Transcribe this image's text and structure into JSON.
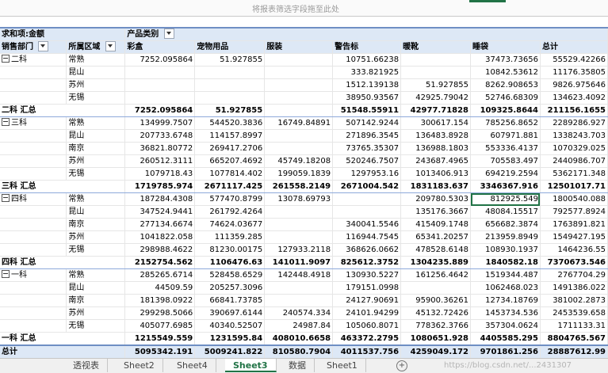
{
  "filter_drop_text": "将报表筛选字段拖至此处",
  "header": {
    "corner": "求和项:金额",
    "col_field": "产品类别",
    "row_field1": "销售部门",
    "row_field2": "所属区域",
    "columns": [
      "彩盒",
      "宠物用品",
      "服装",
      "警告标",
      "暖靴",
      "睡袋",
      "总计"
    ]
  },
  "rows": [
    {
      "type": "first",
      "dept": "二科",
      "region": "常熟",
      "vals": [
        "7252.095864",
        "51.927855",
        "",
        "10751.66238",
        "",
        "37473.73656",
        "55529.42266"
      ]
    },
    {
      "type": "item",
      "region": "昆山",
      "vals": [
        "",
        "",
        "",
        "333.821925",
        "",
        "10842.53612",
        "11176.35805"
      ]
    },
    {
      "type": "item",
      "region": "苏州",
      "vals": [
        "",
        "",
        "",
        "1512.139138",
        "51.927855",
        "8262.908653",
        "9826.975646"
      ]
    },
    {
      "type": "item",
      "region": "无锡",
      "vals": [
        "",
        "",
        "",
        "38950.93567",
        "42925.79042",
        "52746.68309",
        "134623.4092"
      ]
    },
    {
      "type": "sub",
      "label": "二科 汇总",
      "vals": [
        "7252.095864",
        "51.927855",
        "",
        "51548.55911",
        "42977.71828",
        "109325.8644",
        "211156.1655"
      ]
    },
    {
      "type": "first",
      "dept": "三科",
      "region": "常熟",
      "vals": [
        "134999.7507",
        "544520.3836",
        "16749.84891",
        "507142.9244",
        "300617.154",
        "785256.8652",
        "2289286.927"
      ]
    },
    {
      "type": "item",
      "region": "昆山",
      "vals": [
        "207733.6748",
        "114157.8997",
        "",
        "271896.3545",
        "136483.8928",
        "607971.881",
        "1338243.703"
      ]
    },
    {
      "type": "item",
      "region": "南京",
      "vals": [
        "36821.80772",
        "269417.2706",
        "",
        "73765.35307",
        "136988.1803",
        "553336.4137",
        "1070329.025"
      ]
    },
    {
      "type": "item",
      "region": "苏州",
      "vals": [
        "260512.3111",
        "665207.4692",
        "45749.18208",
        "520246.7507",
        "243687.4965",
        "705583.497",
        "2440986.707"
      ]
    },
    {
      "type": "item",
      "region": "无锡",
      "vals": [
        "1079718.43",
        "1077814.402",
        "199059.1839",
        "1297953.16",
        "1013406.913",
        "694219.2594",
        "5362171.348"
      ]
    },
    {
      "type": "sub",
      "label": "三科 汇总",
      "vals": [
        "1719785.974",
        "2671117.425",
        "261558.2149",
        "2671004.542",
        "1831183.637",
        "3346367.916",
        "12501017.71"
      ]
    },
    {
      "type": "first",
      "dept": "四科",
      "region": "常熟",
      "vals": [
        "187284.4308",
        "577470.8799",
        "13078.69793",
        "",
        "209780.5303",
        "812925.549",
        "1800540.088"
      ],
      "sel": 5
    },
    {
      "type": "item",
      "region": "昆山",
      "vals": [
        "347524.9441",
        "261792.4264",
        "",
        "",
        "135176.3667",
        "48084.15517",
        "792577.8924"
      ]
    },
    {
      "type": "item",
      "region": "南京",
      "vals": [
        "277134.6674",
        "74624.03677",
        "",
        "340041.5546",
        "415409.1748",
        "656682.3874",
        "1763891.821"
      ]
    },
    {
      "type": "item",
      "region": "苏州",
      "vals": [
        "1041822.058",
        "111359.285",
        "",
        "116944.7545",
        "65341.20257",
        "213959.8949",
        "1549427.195"
      ]
    },
    {
      "type": "item",
      "region": "无锡",
      "vals": [
        "298988.4622",
        "81230.00175",
        "127933.2118",
        "368626.0662",
        "478528.6148",
        "108930.1937",
        "1464236.55"
      ]
    },
    {
      "type": "sub",
      "label": "四科 汇总",
      "vals": [
        "2152754.562",
        "1106476.63",
        "141011.9097",
        "825612.3752",
        "1304235.889",
        "1840582.18",
        "7370673.546"
      ]
    },
    {
      "type": "first",
      "dept": "一科",
      "region": "常熟",
      "vals": [
        "285265.6714",
        "528458.6529",
        "142448.4918",
        "130930.5227",
        "161256.4642",
        "1519344.487",
        "2767704.29"
      ]
    },
    {
      "type": "item",
      "region": "昆山",
      "vals": [
        "44509.59",
        "205257.3096",
        "",
        "179151.0998",
        "",
        "1062468.023",
        "1491386.022"
      ]
    },
    {
      "type": "item",
      "region": "南京",
      "vals": [
        "181398.0922",
        "66841.73785",
        "",
        "24127.90691",
        "95900.36261",
        "12734.18769",
        "381002.2873"
      ]
    },
    {
      "type": "item",
      "region": "苏州",
      "vals": [
        "299298.5066",
        "390697.6144",
        "240574.334",
        "24101.94299",
        "45132.72426",
        "1453734.536",
        "2453539.658"
      ]
    },
    {
      "type": "item",
      "region": "无锡",
      "vals": [
        "405077.6985",
        "40340.52507",
        "24987.84",
        "105060.8071",
        "778362.3766",
        "357304.0624",
        "1711133.31"
      ]
    },
    {
      "type": "sub",
      "label": "一科 汇总",
      "vals": [
        "1215549.559",
        "1231595.84",
        "408010.6658",
        "463372.2795",
        "1080651.928",
        "4405585.295",
        "8804765.567"
      ]
    },
    {
      "type": "total",
      "label": "总计",
      "vals": [
        "5095342.191",
        "5009241.822",
        "810580.7904",
        "4011537.756",
        "4259049.172",
        "9701861.256",
        "28887612.99"
      ]
    }
  ],
  "tabs": [
    "透视表",
    "Sheet2",
    "Sheet4",
    "Sheet3",
    "数据",
    "Sheet1"
  ],
  "active_tab": "Sheet3",
  "watermark": "https://blog.csdn.net/...2431307"
}
